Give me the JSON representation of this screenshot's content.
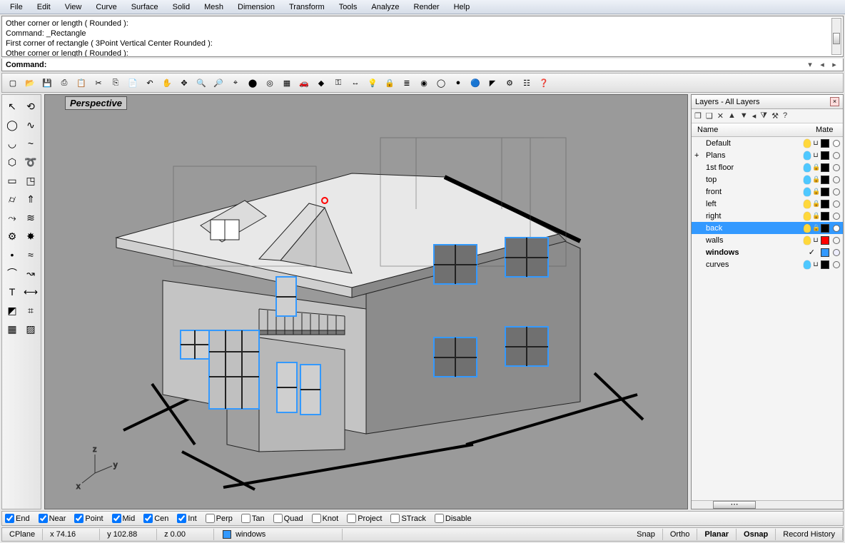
{
  "menu": [
    "File",
    "Edit",
    "View",
    "Curve",
    "Surface",
    "Solid",
    "Mesh",
    "Dimension",
    "Transform",
    "Tools",
    "Analyze",
    "Render",
    "Help"
  ],
  "cmdlog": [
    "Other corner or length ( Rounded ):",
    "Command: _Rectangle",
    "First corner of rectangle ( 3Point  Vertical  Center  Rounded ):",
    "Other corner or length ( Rounded ):"
  ],
  "cmdprompt": "Command:",
  "viewport": {
    "label": "Perspective",
    "axes": [
      "z",
      "y",
      "x"
    ]
  },
  "layers_panel": {
    "title": "Layers - All Layers",
    "cols": {
      "name": "Name",
      "mate": "Mate"
    },
    "rows": [
      {
        "name": "Default",
        "expand": "",
        "bulb": "y",
        "lock": "open",
        "color": "#000000",
        "mat": "circle"
      },
      {
        "name": "Plans",
        "expand": "+",
        "bulb": "c",
        "lock": "open",
        "color": "#000000"
      },
      {
        "name": "1st floor",
        "indent": 1,
        "bulb": "c",
        "lock": "closed",
        "color": "#000000"
      },
      {
        "name": "top",
        "indent": 1,
        "bulb": "c",
        "lock": "closed",
        "color": "#000000"
      },
      {
        "name": "front",
        "indent": 1,
        "bulb": "c",
        "lock": "closed",
        "color": "#000000"
      },
      {
        "name": "left",
        "indent": 1,
        "bulb": "y",
        "lock": "closed",
        "color": "#000000"
      },
      {
        "name": "right",
        "indent": 1,
        "bulb": "y",
        "lock": "closed",
        "color": "#000000"
      },
      {
        "name": "back",
        "indent": 1,
        "bulb": "y",
        "lock": "closed",
        "color": "#000000",
        "sel": true,
        "mat": "circle"
      },
      {
        "name": "walls",
        "indent": 1,
        "bulb": "y",
        "lock": "open",
        "color": "#ff0000"
      },
      {
        "name": "windows",
        "indent": 1,
        "current": true,
        "color": "#3399ff",
        "mat": "light"
      },
      {
        "name": "curves",
        "indent": 1,
        "bulb": "c",
        "lock": "open",
        "color": "#000000"
      }
    ]
  },
  "osnaps": [
    {
      "label": "End",
      "on": true
    },
    {
      "label": "Near",
      "on": true
    },
    {
      "label": "Point",
      "on": true
    },
    {
      "label": "Mid",
      "on": true
    },
    {
      "label": "Cen",
      "on": true
    },
    {
      "label": "Int",
      "on": true
    },
    {
      "label": "Perp",
      "on": false
    },
    {
      "label": "Tan",
      "on": false
    },
    {
      "label": "Quad",
      "on": false
    },
    {
      "label": "Knot",
      "on": false
    },
    {
      "label": "Project",
      "on": false
    },
    {
      "label": "STrack",
      "on": false,
      "boxcolor": "#6688bb"
    },
    {
      "label": "Disable",
      "on": false
    }
  ],
  "status": {
    "cplane": "CPlane",
    "x": "x 74.16",
    "y": "y 102.88",
    "z": "z 0.00",
    "layer_swatch": "#3399ff",
    "layer": "windows",
    "panes": [
      "Snap",
      "Ortho",
      "Planar",
      "Osnap",
      "Record History"
    ]
  },
  "toolbar_icons": [
    "new-icon",
    "open-icon",
    "save-icon",
    "print-icon",
    "paste-icon",
    "cut-icon",
    "copy-icon",
    "clipboard-icon",
    "undo-icon",
    "pan-icon",
    "move-icon",
    "zoom-in-icon",
    "zoom-out-icon",
    "zoom-window-icon",
    "zoom-selected-icon",
    "zoom-extents-icon",
    "grid-icon",
    "car-icon",
    "render-icon",
    "key-icon",
    "dim-icon",
    "light-off-icon",
    "lock-icon",
    "layer-stack-icon",
    "color-wheel-icon",
    "sphere-wire-icon",
    "sphere-shaded-icon",
    "sphere-blue-icon",
    "cplane-icon",
    "options-icon",
    "tree-icon",
    "help-icon"
  ],
  "left_icons": [
    "arrow",
    "lasso",
    "circle",
    "curve",
    "arc",
    "pcurve",
    "polygon",
    "trace",
    "rect",
    "box",
    "cyl",
    "extrude",
    "sweep",
    "loft",
    "gear",
    "explode",
    "dot",
    "blend",
    "pipe",
    "flow",
    "text",
    "dim",
    "cplane",
    "ucs",
    "mesh",
    "hatch"
  ]
}
